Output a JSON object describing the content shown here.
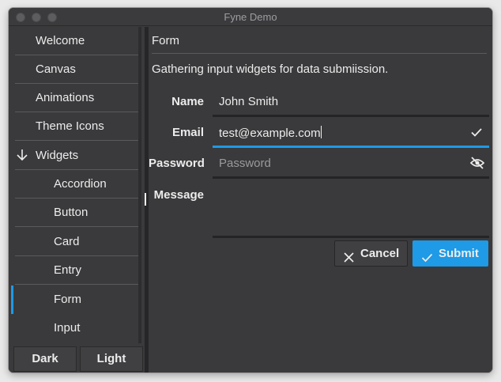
{
  "window": {
    "title": "Fyne Demo"
  },
  "sidebar": {
    "items": [
      {
        "label": "Welcome"
      },
      {
        "label": "Canvas"
      },
      {
        "label": "Animations"
      },
      {
        "label": "Theme Icons"
      },
      {
        "label": "Widgets",
        "expanded": true,
        "icon": "arrow-down-icon"
      },
      {
        "label": "Accordion"
      },
      {
        "label": "Button"
      },
      {
        "label": "Card"
      },
      {
        "label": "Entry"
      },
      {
        "label": "Form",
        "selected": true
      },
      {
        "label": "Input"
      }
    ],
    "theme_buttons": {
      "dark": "Dark",
      "light": "Light"
    }
  },
  "main": {
    "title": "Form",
    "intro": "Gathering input widgets for data submiission.",
    "form": {
      "name": {
        "label": "Name",
        "value": "John Smith"
      },
      "email": {
        "label": "Email",
        "value": "test@example.com",
        "icon": "check-icon"
      },
      "password": {
        "label": "Password",
        "placeholder": "Password",
        "icon": "eye-off-icon"
      },
      "message": {
        "label": "Message",
        "value": ""
      }
    },
    "buttons": {
      "cancel": "Cancel",
      "submit": "Submit"
    }
  },
  "colors": {
    "accent": "#1e9ae6",
    "background": "#3a3a3c",
    "text": "#ececec"
  }
}
